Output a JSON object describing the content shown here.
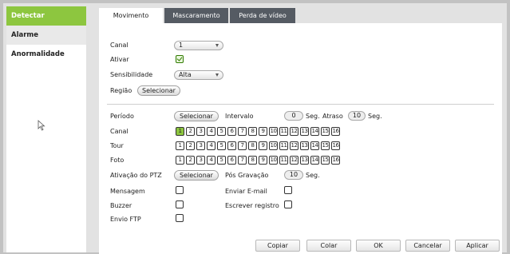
{
  "sidebar": {
    "items": [
      {
        "label": "Detectar"
      },
      {
        "label": "Alarme"
      },
      {
        "label": "Anormalidade"
      }
    ]
  },
  "tabs": [
    {
      "label": "Movimento"
    },
    {
      "label": "Mascaramento"
    },
    {
      "label": "Perda de vídeo"
    }
  ],
  "form": {
    "canal_label": "Canal",
    "canal_value": "1",
    "ativar_label": "Ativar",
    "ativar_checked": true,
    "sensibilidade_label": "Sensibilidade",
    "sensibilidade_value": "Alta",
    "regiao_label": "Região",
    "regiao_button": "Selecionar",
    "periodo_label": "Período",
    "periodo_button": "Selecionar",
    "intervalo_label": "Intervalo",
    "intervalo_value": "0",
    "intervalo_unit": "Seg.",
    "atraso_label": "Atraso",
    "atraso_value": "10",
    "atraso_unit": "Seg.",
    "canal2_label": "Canal",
    "tour_label": "Tour",
    "foto_label": "Foto",
    "ptz_label": "Ativação do PTZ",
    "ptz_button": "Selecionar",
    "pos_gravacao_label": "Pós Gravação",
    "pos_gravacao_value": "10",
    "pos_gravacao_unit": "Seg.",
    "mensagem_label": "Mensagem",
    "enviar_email_label": "Enviar E-mail",
    "buzzer_label": "Buzzer",
    "escrever_registro_label": "Escrever registro",
    "envio_ftp_label": "Envio FTP"
  },
  "channels": [
    "1",
    "2",
    "3",
    "4",
    "5",
    "6",
    "7",
    "8",
    "9",
    "10",
    "11",
    "12",
    "13",
    "14",
    "15",
    "16"
  ],
  "selected_channel_record": "1",
  "buttons": {
    "copiar": "Copiar",
    "colar": "Colar",
    "ok": "OK",
    "cancelar": "Cancelar",
    "aplicar": "Aplicar"
  },
  "colors": {
    "accent": "#8dc63f",
    "tab_inactive": "#555b63",
    "background": "#c2c2c2"
  }
}
